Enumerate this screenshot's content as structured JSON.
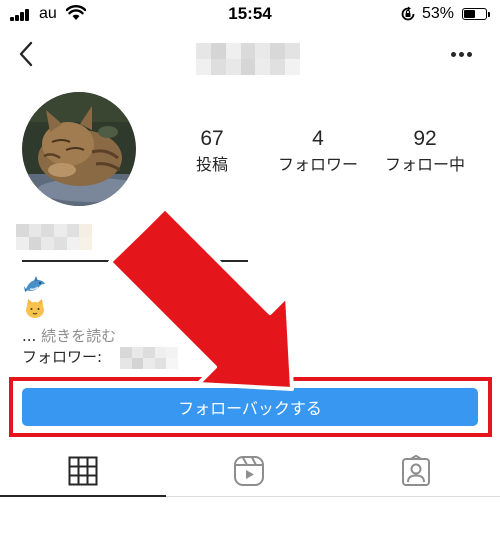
{
  "status_bar": {
    "carrier": "au",
    "time": "15:54",
    "battery_percent_label": "53%",
    "battery_level": 0.53,
    "icons": [
      "signal-icon",
      "wifi-icon",
      "rotation-lock-icon",
      "battery-icon"
    ]
  },
  "header": {
    "icons": [
      "back-chevron-icon",
      "more-options-icon"
    ]
  },
  "profile": {
    "avatar": "cat-avatar",
    "stats": [
      {
        "count": "67",
        "label": "投稿"
      },
      {
        "count": "4",
        "label": "フォロワー"
      },
      {
        "count": "92",
        "label": "フォロー中"
      }
    ],
    "bio_emojis": [
      "dolphin-emoji",
      "cat-face-emoji"
    ],
    "read_more": {
      "prefix": "...",
      "label": "続きを読む"
    },
    "followers_label": "フォロワー:"
  },
  "actions": {
    "follow_back_label": "フォローバックする"
  },
  "tabs": [
    {
      "name": "grid-tab",
      "icon": "grid-icon",
      "active": true
    },
    {
      "name": "reels-tab",
      "icon": "reels-icon",
      "active": false
    },
    {
      "name": "tagged-tab",
      "icon": "tagged-person-icon",
      "active": false
    }
  ],
  "colors": {
    "accent_blue": "#3897f0",
    "annotation_red": "#e5161b",
    "text": "#262626",
    "muted_text": "#8e8e8e"
  }
}
